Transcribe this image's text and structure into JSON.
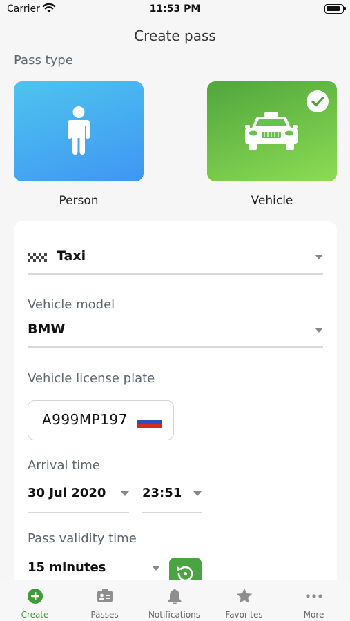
{
  "status_bar": {
    "carrier": "Carrier",
    "time": "11:53 PM"
  },
  "nav": {
    "title": "Create pass"
  },
  "pass_type": {
    "label": "Pass type",
    "options": [
      {
        "label": "Person",
        "icon": "person-icon",
        "selected": false
      },
      {
        "label": "Vehicle",
        "icon": "car-icon",
        "selected": true
      }
    ]
  },
  "form": {
    "service": {
      "value": "Taxi",
      "icon": "checker-icon"
    },
    "vehicle_model": {
      "label": "Vehicle model",
      "value": "BMW"
    },
    "license_plate": {
      "label": "Vehicle license plate",
      "value": "A999MP197",
      "flag": "russia-flag"
    },
    "arrival_time": {
      "label": "Arrival time",
      "date": "30 Jul 2020",
      "time": "23:51"
    },
    "validity": {
      "label": "Pass validity time",
      "value": "15 minutes"
    }
  },
  "tabs": [
    {
      "label": "Create",
      "icon": "plus-circle-icon",
      "active": true
    },
    {
      "label": "Passes",
      "icon": "id-card-icon",
      "active": false
    },
    {
      "label": "Notifications",
      "icon": "bell-icon",
      "active": false
    },
    {
      "label": "Favorites",
      "icon": "star-icon",
      "active": false
    },
    {
      "label": "More",
      "icon": "more-dots-icon",
      "active": false
    }
  ],
  "colors": {
    "accent_green": "#4aa441",
    "person_card": "#3f96f3",
    "vehicle_card": "#6cc24a",
    "label_gray": "#5f6670"
  }
}
